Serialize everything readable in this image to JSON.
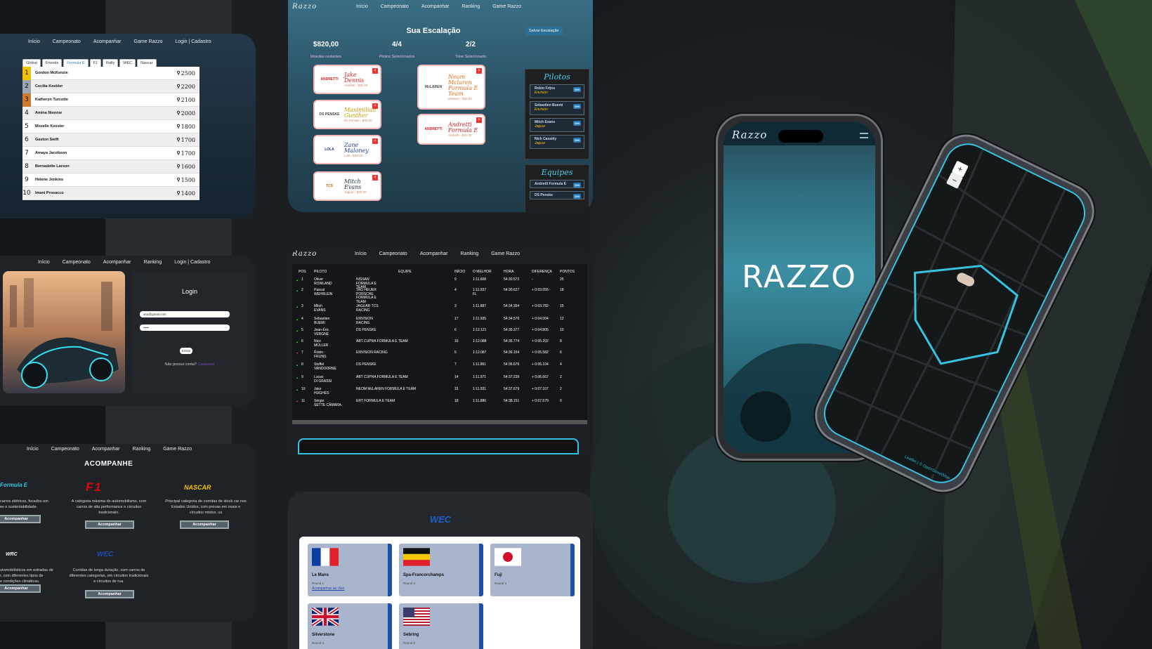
{
  "nav": {
    "inicio": "Início",
    "campeonato": "Campeonato",
    "acompanhar": "Acompanhar",
    "ranking": "Ranking",
    "game": "Game Razzo",
    "login": "Login | Cadastro"
  },
  "logo": "Razzo",
  "ranking": {
    "tabs": [
      "Global",
      "Friends",
      "Formula E",
      "F1",
      "Rally",
      "WEC",
      "Nascar"
    ],
    "rows": [
      {
        "pos": "1",
        "name": "Gordon McKenzie",
        "pts": "2500"
      },
      {
        "pos": "2",
        "name": "Cecilia Keebler",
        "pts": "2200"
      },
      {
        "pos": "3",
        "name": "Katheryn Turcotte",
        "pts": "2100"
      },
      {
        "pos": "4",
        "name": "Amina Nienow",
        "pts": "2000"
      },
      {
        "pos": "5",
        "name": "Mozelle Kessler",
        "pts": "1800"
      },
      {
        "pos": "6",
        "name": "Gaston Swift",
        "pts": "1700"
      },
      {
        "pos": "7",
        "name": "Amaya Jacobson",
        "pts": "1700"
      },
      {
        "pos": "8",
        "name": "Bernadette Larson",
        "pts": "1600"
      },
      {
        "pos": "9",
        "name": "Helene Jenkins",
        "pts": "1500"
      },
      {
        "pos": "10",
        "name": "Imani Prosacco",
        "pts": "1400"
      }
    ]
  },
  "lineup": {
    "title": "Sua Escalação",
    "save": "Salvar Escalação",
    "coins": "$820,00",
    "coins_label": "Moedas restantes",
    "pilots": "4/4",
    "pilots_label": "Pilotos Selecionados",
    "team": "2/2",
    "team_label": "Time Selecionado",
    "drivers": [
      {
        "name": "Jake Dennis",
        "sub": "Andretti - $30,00",
        "logo": "ANDRETTI"
      },
      {
        "name": "Maximilian Gunther",
        "sub": "Ds Penske - $30,00",
        "logo": "DS PENSKE"
      },
      {
        "name": "Zane Maloney",
        "sub": "Lola - $30,00",
        "logo": "LOLA"
      },
      {
        "name": "Mitch Evans",
        "sub": "Jaguar - $30,00",
        "logo": "TCS"
      }
    ],
    "teams": [
      {
        "name": "Neom Mclaren Formula E Team",
        "sub": "Mclaren - $30,00",
        "logo": "McLAREN"
      },
      {
        "name": "Andretti Formula E",
        "sub": "Andretti - $30,00",
        "logo": "ANDRETTI"
      }
    ],
    "side_pilots_title": "Pilotos",
    "side_pilots": [
      {
        "name": "Robin Frijns",
        "team": "Envision",
        "price": "$30"
      },
      {
        "name": "Sebastien Buemi",
        "team": "Envision",
        "price": "$30"
      },
      {
        "name": "Mitch Evans",
        "team": "Jaguar",
        "price": "$30"
      },
      {
        "name": "Nick Cassidy",
        "team": "Jaguar",
        "price": "$30"
      }
    ],
    "side_teams_title": "Equipes",
    "side_teams": [
      {
        "name": "Andretti Formula E",
        "price": "$30"
      },
      {
        "name": "DS Penske",
        "price": "$30"
      }
    ]
  },
  "login": {
    "title": "Login",
    "email": "ana@gmail.com",
    "password": "•••••",
    "button": "Entrar",
    "question": "Não possui conta?",
    "link": "Cadastrar"
  },
  "results": {
    "headers": [
      "POS",
      "PILOTO",
      "EQUIPE",
      "INÍCIO",
      "O MELHOR",
      "HORA",
      "DIFERENÇA",
      "PONTOS"
    ],
    "rows": [
      {
        "pos": "1",
        "driver": "Oliver\nROWLAND",
        "team": "NISSAN\nFORMULA E\nTEAM",
        "start": "9",
        "best": "1:11.608",
        "time": "54:30.572",
        "diff": "-",
        "pts": "25",
        "up": true
      },
      {
        "pos": "2",
        "driver": "Pascal\nWEHRLEIN",
        "team": "TAG HEUER\nPORSCHE\nFORMULA E\nTEAM",
        "start": "4",
        "best": "1:11.937\nFL",
        "time": "54:30.627",
        "diff": "+ 0:03.055",
        "pts": "18",
        "up": true
      },
      {
        "pos": "3",
        "driver": "Mitch\nEVANS",
        "team": "JAGUAR TCS\nRACING",
        "start": "3",
        "best": "1:11.887",
        "time": "54:34.354",
        "diff": "+ 0:03.782",
        "pts": "15",
        "up": true
      },
      {
        "pos": "4",
        "driver": "Sebastien\nBUEMI",
        "team": "ENVISION\nRACING",
        "start": "17",
        "best": "1:11.935",
        "time": "54:34.576",
        "diff": "+ 0:04.004",
        "pts": "12",
        "up": true
      },
      {
        "pos": "5",
        "driver": "Jean-Éric\nVERGNE",
        "team": "DS PENSKE",
        "start": "6",
        "best": "1:12.121",
        "time": "54:35.377",
        "diff": "+ 0:04.805",
        "pts": "10",
        "up": true
      },
      {
        "pos": "6",
        "driver": "Nico\nMÜLLER",
        "team": "ABT CUPRA FORMULA E TEAM",
        "start": "16",
        "best": "1:12.088",
        "time": "54:35.774",
        "diff": "+ 0:05.202",
        "pts": "8",
        "up": true
      },
      {
        "pos": "7",
        "driver": "Robin\nFRIJNS",
        "team": "ENVISION RACING",
        "start": "5",
        "best": "1:12.087",
        "time": "54:36.154",
        "diff": "+ 0:05.582",
        "pts": "6",
        "up": false
      },
      {
        "pos": "8",
        "driver": "Stoffel\nVANDOORNE",
        "team": "DS PENSKE",
        "start": "7",
        "best": "1:11.861",
        "time": "54:36.676",
        "diff": "+ 0:06.104",
        "pts": "4",
        "up": true
      },
      {
        "pos": "9",
        "driver": "Lucas\nDI GRASSI",
        "team": "ABT CUPRA FORMULA E TEAM",
        "start": "14",
        "best": "1:11.971",
        "time": "54:37.239",
        "diff": "+ 0:06.667",
        "pts": "2",
        "up": true
      },
      {
        "pos": "10",
        "driver": "Jake\nHUGHES",
        "team": "NEOM McLAREN FORMULA E TEAM",
        "start": "15",
        "best": "1:11.931",
        "time": "54:37.679",
        "diff": "+ 0:07.107",
        "pts": "2",
        "up": true
      },
      {
        "pos": "11",
        "driver": "Sérgio\nSETTE CÂMARA",
        "team": "ERT FORMULA E TEAM",
        "start": "18",
        "best": "1:11.886",
        "time": "54:38.151",
        "diff": "+ 0:07.579",
        "pts": "0",
        "up": false
      }
    ]
  },
  "follow": {
    "title": "ACOMPANHE",
    "button": "Acompanhar",
    "items": [
      {
        "logo": "Formula E",
        "desc": "carros elétricos, focados em\nes e sustentabilidade."
      },
      {
        "logo": "F1",
        "desc": "A categoria máxima do automobilismo, com\ncarros de alta performance e circuitos\ntradicionais."
      },
      {
        "logo": "NASCAR",
        "desc": "Principal categoria de corridas de stock car nos\nEstados Unidos, com provas em ovais e\ncircuitos mistos. us"
      },
      {
        "logo": "WRC",
        "desc": "utomobilísticos em estradas de\nr, com diferentes tipos de\ne condições climáticas."
      },
      {
        "logo": "WEC",
        "desc": "Corridas de longa duração, com carros de\ndiferentes categorias, em circuitos tradicionais\ne circuitos de rua."
      }
    ]
  },
  "wec": {
    "title": "WEC",
    "races": [
      {
        "name": "Le Mans",
        "round": "Round 1",
        "link": "Acompanhar ao Vivo",
        "flag": "france"
      },
      {
        "name": "Spa-Francorchamps",
        "round": "Round 2",
        "flag": "belgium"
      },
      {
        "name": "Fuji",
        "round": "Round 3",
        "flag": "japan"
      },
      {
        "name": "Silverstone",
        "round": "Round 4",
        "flag": "uk"
      },
      {
        "name": "Sebring",
        "round": "Round 5",
        "flag": "usa"
      }
    ]
  },
  "phone": {
    "app_logo": "Razzo",
    "splash": "RAZZO",
    "map_attrib": "Leaflet | © OpenStreetMap",
    "zoom_in": "+",
    "zoom_out": "−"
  },
  "colors": {
    "accent": "#35c3e0",
    "bg": "#1b1f22",
    "gold": "#f2c200"
  }
}
